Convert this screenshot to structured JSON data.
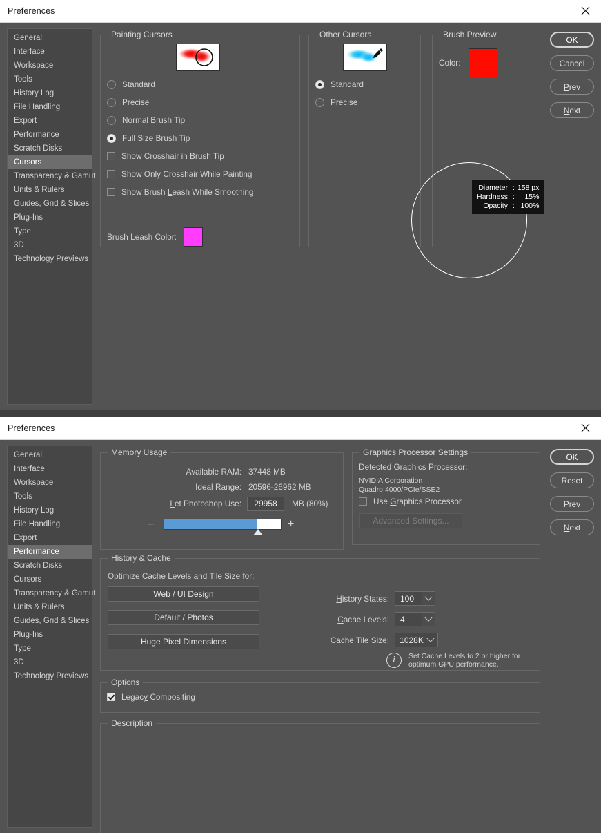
{
  "window_title": "Preferences",
  "sidebar_items": [
    "General",
    "Interface",
    "Workspace",
    "Tools",
    "History Log",
    "File Handling",
    "Export",
    "Performance",
    "Scratch Disks",
    "Cursors",
    "Transparency & Gamut",
    "Units & Rulers",
    "Guides, Grid & Slices",
    "Plug-Ins",
    "Type",
    "3D",
    "Technology Previews"
  ],
  "cursors_dialog": {
    "title": "Preferences",
    "selected_sidebar": "Cursors",
    "painting_cursors": {
      "legend": "Painting Cursors",
      "options": [
        {
          "label_pre": "S",
          "label_mn": "t",
          "label_post": "andard",
          "text": "Standard",
          "selected": false
        },
        {
          "label_pre": "P",
          "label_mn": "r",
          "label_post": "ecise",
          "text": "Precise",
          "selected": false
        },
        {
          "label_pre": "Normal ",
          "label_mn": "B",
          "label_post": "rush Tip",
          "text": "Normal Brush Tip",
          "selected": false
        },
        {
          "label_pre": "",
          "label_mn": "F",
          "label_post": "ull Size Brush Tip",
          "text": "Full Size Brush Tip",
          "selected": true
        }
      ],
      "checkboxes": [
        {
          "label_pre": "Show ",
          "label_mn": "C",
          "label_post": "rosshair in Brush Tip",
          "text": "Show Crosshair in Brush Tip",
          "checked": false
        },
        {
          "label_pre": "Show Only Crosshair ",
          "label_mn": "W",
          "label_post": "hile Painting",
          "text": "Show Only Crosshair While Painting",
          "checked": false
        },
        {
          "label_pre": "Show Brush ",
          "label_mn": "L",
          "label_post": "eash While Smoothing",
          "text": "Show Brush Leash While Smoothing",
          "checked": false
        }
      ],
      "leash_color_label": "Brush Leash Color:",
      "leash_color": "#FF3CFF"
    },
    "other_cursors": {
      "legend": "Other Cursors",
      "options": [
        {
          "label_pre": "S",
          "label_mn": "t",
          "label_post": "andard",
          "text": "Standard",
          "selected": true
        },
        {
          "label_pre": "Precis",
          "label_mn": "e",
          "label_post": "",
          "text": "Precise",
          "selected": false
        }
      ]
    },
    "brush_preview": {
      "legend": "Brush Preview",
      "color_label": "Color:",
      "color": "#FF0C00",
      "tooltip": {
        "rows": [
          {
            "key": "Diameter",
            "sep": ":",
            "value": "158 px"
          },
          {
            "key": "Hardness",
            "sep": ":",
            "value": "15%"
          },
          {
            "key": "Opacity",
            "sep": ":",
            "value": "100%"
          }
        ]
      }
    },
    "buttons": [
      {
        "text": "OK",
        "pre": "",
        "mn": "",
        "post": "OK",
        "primary": true
      },
      {
        "text": "Cancel",
        "pre": "Cancel",
        "mn": "",
        "post": "",
        "primary": false
      },
      {
        "text": "Prev",
        "pre": "",
        "mn": "P",
        "post": "rev",
        "primary": false
      },
      {
        "text": "Next",
        "pre": "",
        "mn": "N",
        "post": "ext",
        "primary": false
      }
    ]
  },
  "performance_dialog": {
    "title": "Preferences",
    "selected_sidebar": "Performance",
    "memory_usage": {
      "legend": "Memory Usage",
      "available_ram_label": "Available RAM:",
      "available_ram_value": "37448 MB",
      "ideal_range_label": "Ideal Range:",
      "ideal_range_value": "20596-26962 MB",
      "let_use_label_pre": "",
      "let_use_label_mn": "L",
      "let_use_label_post": "et Photoshop Use:",
      "let_use_label": "Let Photoshop Use:",
      "let_use_value": "29958",
      "unit_label": "MB (80%)",
      "slider_percent": 80,
      "minus": "−",
      "plus": "+"
    },
    "graphics": {
      "legend": "Graphics Processor Settings",
      "detected_label": "Detected Graphics Processor:",
      "vendor": "NVIDIA Corporation",
      "model": "Quadro 4000/PCIe/SSE2",
      "use_gpu_pre": "Use ",
      "use_gpu_mn": "G",
      "use_gpu_post": "raphics Processor",
      "use_gpu_label": "Use Graphics Processor",
      "use_gpu_checked": false,
      "advanced_button": "Advanced Settings...",
      "advanced_disabled": true
    },
    "history_cache": {
      "legend": "History & Cache",
      "optimize_label": "Optimize Cache Levels and Tile Size for:",
      "preset_buttons": [
        "Web / UI Design",
        "Default / Photos",
        "Huge Pixel Dimensions"
      ],
      "history_states_pre": "",
      "history_states_mn": "H",
      "history_states_post": "istory States:",
      "history_states_label": "History States:",
      "history_states_value": "100",
      "cache_levels_pre": "",
      "cache_levels_mn": "C",
      "cache_levels_post": "ache Levels:",
      "cache_levels_label": "Cache Levels:",
      "cache_levels_value": "4",
      "cache_tile_pre": "Cache Tile Si",
      "cache_tile_mn": "z",
      "cache_tile_post": "e:",
      "cache_tile_label": "Cache Tile Size:",
      "cache_tile_value": "1028K",
      "hint_line1": "Set Cache Levels to 2 or higher for",
      "hint_line2": "optimum GPU performance.",
      "info_glyph": "i"
    },
    "options": {
      "legend": "Options",
      "legacy_pre": "Legac",
      "legacy_mn": "y",
      "legacy_post": " Compositing",
      "legacy_label": "Legacy Compositing",
      "legacy_checked": true
    },
    "description": {
      "legend": "Description",
      "text": ""
    },
    "buttons": [
      {
        "text": "OK",
        "pre": "OK",
        "mn": "",
        "post": "",
        "primary": true
      },
      {
        "text": "Reset",
        "pre": "Reset",
        "mn": "",
        "post": "",
        "primary": false
      },
      {
        "text": "Prev",
        "pre": "",
        "mn": "P",
        "post": "rev",
        "primary": false
      },
      {
        "text": "Next",
        "pre": "",
        "mn": "N",
        "post": "ext",
        "primary": false
      }
    ]
  }
}
